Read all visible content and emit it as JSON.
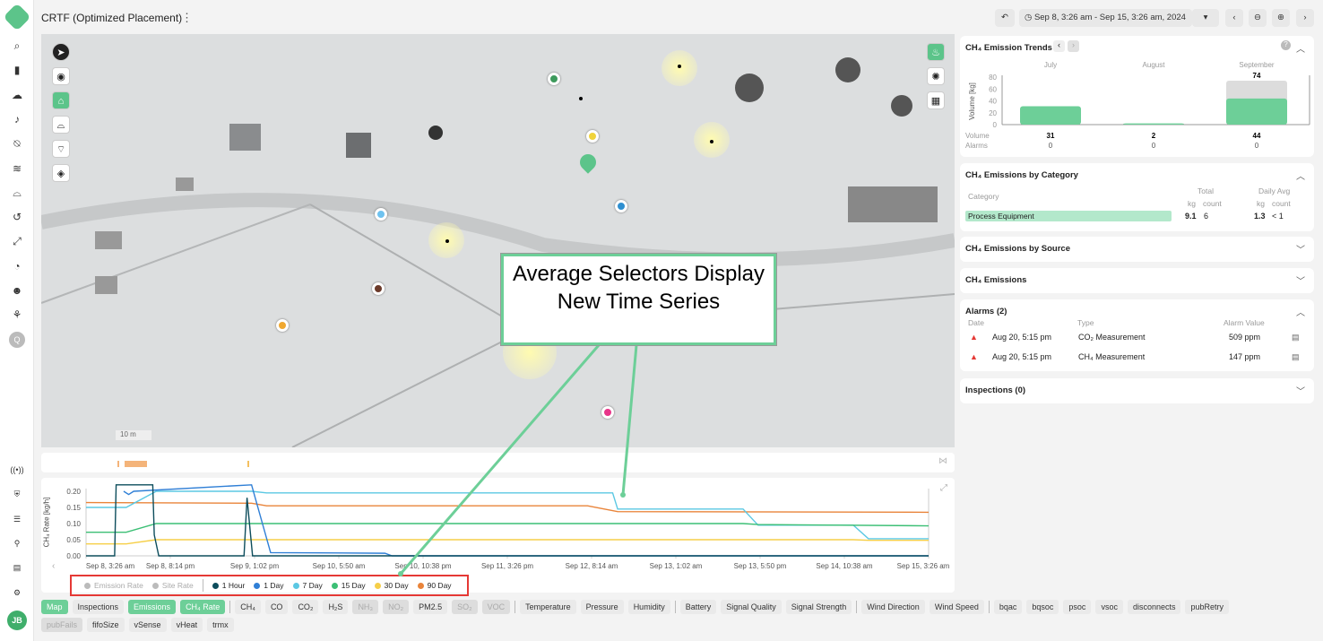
{
  "app": {
    "title": "CRTF (Optimized Placement)",
    "user_initials": "JB"
  },
  "toolbar": {
    "date_range": "Sep 8, 3:26 am - Sep 15, 3:26 am, 2024"
  },
  "sidebar": {
    "icons": [
      "search-icon",
      "bar-chart-icon",
      "cloud-upload-icon",
      "bell-icon",
      "alarm-off-icon",
      "waves-icon",
      "sensor-icon",
      "history-icon",
      "expand-icon",
      "timer-icon",
      "users-icon",
      "network-icon",
      "q-icon"
    ],
    "bottom_icons": [
      "broadcast-settings-icon",
      "sensor-shield-icon",
      "signal-list-icon",
      "map-pin-settings-icon",
      "report-settings-icon",
      "gears-icon"
    ]
  },
  "map": {
    "scale": "10 m"
  },
  "trends": {
    "title": "CH₄ Emission Trends",
    "ylabel": "Volume [kg]",
    "yticks": [
      "80",
      "60",
      "40",
      "20",
      "0"
    ],
    "months": [
      "July",
      "August",
      "September"
    ],
    "volume_label": "Volume",
    "alarms_label": "Alarms",
    "volumes": [
      31,
      2,
      44
    ],
    "totals": [
      null,
      null,
      74
    ],
    "total_label": "74",
    "volume_text": [
      "31",
      "2",
      "44"
    ],
    "alarms": [
      "0",
      "0",
      "0"
    ]
  },
  "category": {
    "title": "CH₄ Emissions by Category",
    "col_category": "Category",
    "col_total": "Total",
    "col_daily": "Daily Avg",
    "kg": "kg",
    "count": "count",
    "rows": [
      {
        "name": "Process Equipment",
        "kg": "9.1",
        "count": "6",
        "daily_kg": "1.3",
        "daily_count": "< 1"
      }
    ]
  },
  "source": {
    "title": "CH₄ Emissions by Source"
  },
  "emissions": {
    "title": "CH₄ Emissions"
  },
  "alarms": {
    "title": "Alarms (2)",
    "col_date": "Date",
    "col_type": "Type",
    "col_value": "Alarm Value",
    "rows": [
      {
        "date": "Aug 20, 5:15 pm",
        "type": "CO₂ Measurement",
        "value": "509 ppm"
      },
      {
        "date": "Aug 20, 5:15 pm",
        "type": "CH₄ Measurement",
        "value": "147 ppm"
      }
    ]
  },
  "inspections": {
    "title": "Inspections (0)"
  },
  "annotation": {
    "text": "Average Selectors Display New Time Series"
  },
  "chart_data": {
    "type": "line",
    "ylabel": "CH₄ Rate [kg/h]",
    "ylim": [
      0,
      0.2
    ],
    "xlim_hours": [
      0,
      168
    ],
    "yticks": [
      "0.20",
      "0.15",
      "0.10",
      "0.05",
      "0.00"
    ],
    "xticks": [
      "Sep 8, 3:26 am",
      "Sep 8, 8:14 pm",
      "Sep 9, 1:02 pm",
      "Sep 10, 5:50 am",
      "Sep 10, 10:38 pm",
      "Sep 11, 3:26 pm",
      "Sep 12, 8:14 am",
      "Sep 13, 1:02 am",
      "Sep 13, 5:50 pm",
      "Sep 14, 10:38 am",
      "Sep 15, 3:26 am"
    ],
    "legend": [
      {
        "name": "Emission Rate",
        "color": "#bbbbbb",
        "disabled": true
      },
      {
        "name": "Site Rate",
        "color": "#bbbbbb",
        "disabled": true
      },
      {
        "name": "1 Hour",
        "color": "#0d4d5c"
      },
      {
        "name": "1 Day",
        "color": "#2f7fd6"
      },
      {
        "name": "7 Day",
        "color": "#5bc8e3"
      },
      {
        "name": "15 Day",
        "color": "#3cbf75"
      },
      {
        "name": "30 Day",
        "color": "#f6cf48"
      },
      {
        "name": "90 Day",
        "color": "#e9843a"
      }
    ],
    "series": [
      {
        "name": "90 Day",
        "color": "#e9843a",
        "points": [
          [
            0,
            0.165
          ],
          [
            33,
            0.163
          ],
          [
            36,
            0.155
          ],
          [
            100,
            0.155
          ],
          [
            106,
            0.137
          ],
          [
            168,
            0.135
          ]
        ]
      },
      {
        "name": "7 Day",
        "color": "#5bc8e3",
        "points": [
          [
            0,
            0.15
          ],
          [
            8,
            0.15
          ],
          [
            14,
            0.2
          ],
          [
            33,
            0.2
          ],
          [
            36,
            0.195
          ],
          [
            105,
            0.195
          ],
          [
            106,
            0.145
          ],
          [
            131,
            0.145
          ],
          [
            134,
            0.095
          ],
          [
            153,
            0.095
          ],
          [
            156,
            0.053
          ],
          [
            168,
            0.053
          ]
        ]
      },
      {
        "name": "15 Day",
        "color": "#3cbf75",
        "points": [
          [
            0,
            0.073
          ],
          [
            8,
            0.073
          ],
          [
            14,
            0.1
          ],
          [
            131,
            0.1
          ],
          [
            134,
            0.097
          ],
          [
            168,
            0.093
          ]
        ]
      },
      {
        "name": "30 Day",
        "color": "#f6cf48",
        "points": [
          [
            0,
            0.037
          ],
          [
            8,
            0.037
          ],
          [
            14,
            0.05
          ],
          [
            153,
            0.05
          ],
          [
            156,
            0.048
          ],
          [
            168,
            0.048
          ]
        ]
      },
      {
        "name": "1 Day",
        "color": "#2f7fd6",
        "points": [
          [
            7.5,
            0.2
          ],
          [
            8.5,
            0.19
          ],
          [
            9.5,
            0.2
          ],
          [
            33,
            0.22
          ],
          [
            36.8,
            0.01
          ],
          [
            59.6,
            0.008
          ],
          [
            61,
            0
          ],
          [
            168,
            0
          ]
        ]
      },
      {
        "name": "1 Hour",
        "color": "#0d4d5c",
        "points": [
          [
            0,
            0
          ],
          [
            5.7,
            0
          ],
          [
            6,
            0.22
          ],
          [
            13.3,
            0.22
          ],
          [
            13.6,
            0.065
          ],
          [
            14.5,
            0
          ],
          [
            31.5,
            0
          ],
          [
            32.1,
            0.18
          ],
          [
            33.2,
            0
          ],
          [
            168,
            0
          ]
        ]
      }
    ]
  },
  "buttons": {
    "row1": [
      {
        "l": "Map",
        "s": "on"
      },
      {
        "l": "Inspections"
      },
      {
        "l": "Emissions",
        "s": "on"
      },
      {
        "l": "CH₄ Rate",
        "s": "on"
      },
      {
        "sep": 1
      },
      {
        "l": "CH₄"
      },
      {
        "l": "CO"
      },
      {
        "l": "CO₂"
      },
      {
        "l": "H₂S"
      },
      {
        "l": "NH₃",
        "s": "dis"
      },
      {
        "l": "NO₂",
        "s": "dis"
      },
      {
        "l": "PM2.5"
      },
      {
        "l": "SO₂",
        "s": "dis"
      },
      {
        "l": "VOC",
        "s": "dis"
      },
      {
        "sep": 1
      },
      {
        "l": "Temperature"
      },
      {
        "l": "Pressure"
      },
      {
        "l": "Humidity"
      },
      {
        "sep": 1
      },
      {
        "l": "Battery"
      },
      {
        "l": "Signal Quality"
      },
      {
        "l": "Signal Strength"
      },
      {
        "sep": 1
      },
      {
        "l": "Wind Direction"
      },
      {
        "l": "Wind Speed"
      },
      {
        "sep": 1
      },
      {
        "l": "bqac"
      },
      {
        "l": "bqsoc"
      },
      {
        "l": "psoc"
      },
      {
        "l": "vsoc"
      },
      {
        "l": "disconnects"
      },
      {
        "l": "pubRetry"
      }
    ],
    "row2": [
      {
        "l": "pubFails",
        "s": "dis"
      },
      {
        "l": "fifoSize"
      },
      {
        "l": "vSense"
      },
      {
        "l": "vHeat"
      },
      {
        "l": "trmx"
      }
    ]
  }
}
